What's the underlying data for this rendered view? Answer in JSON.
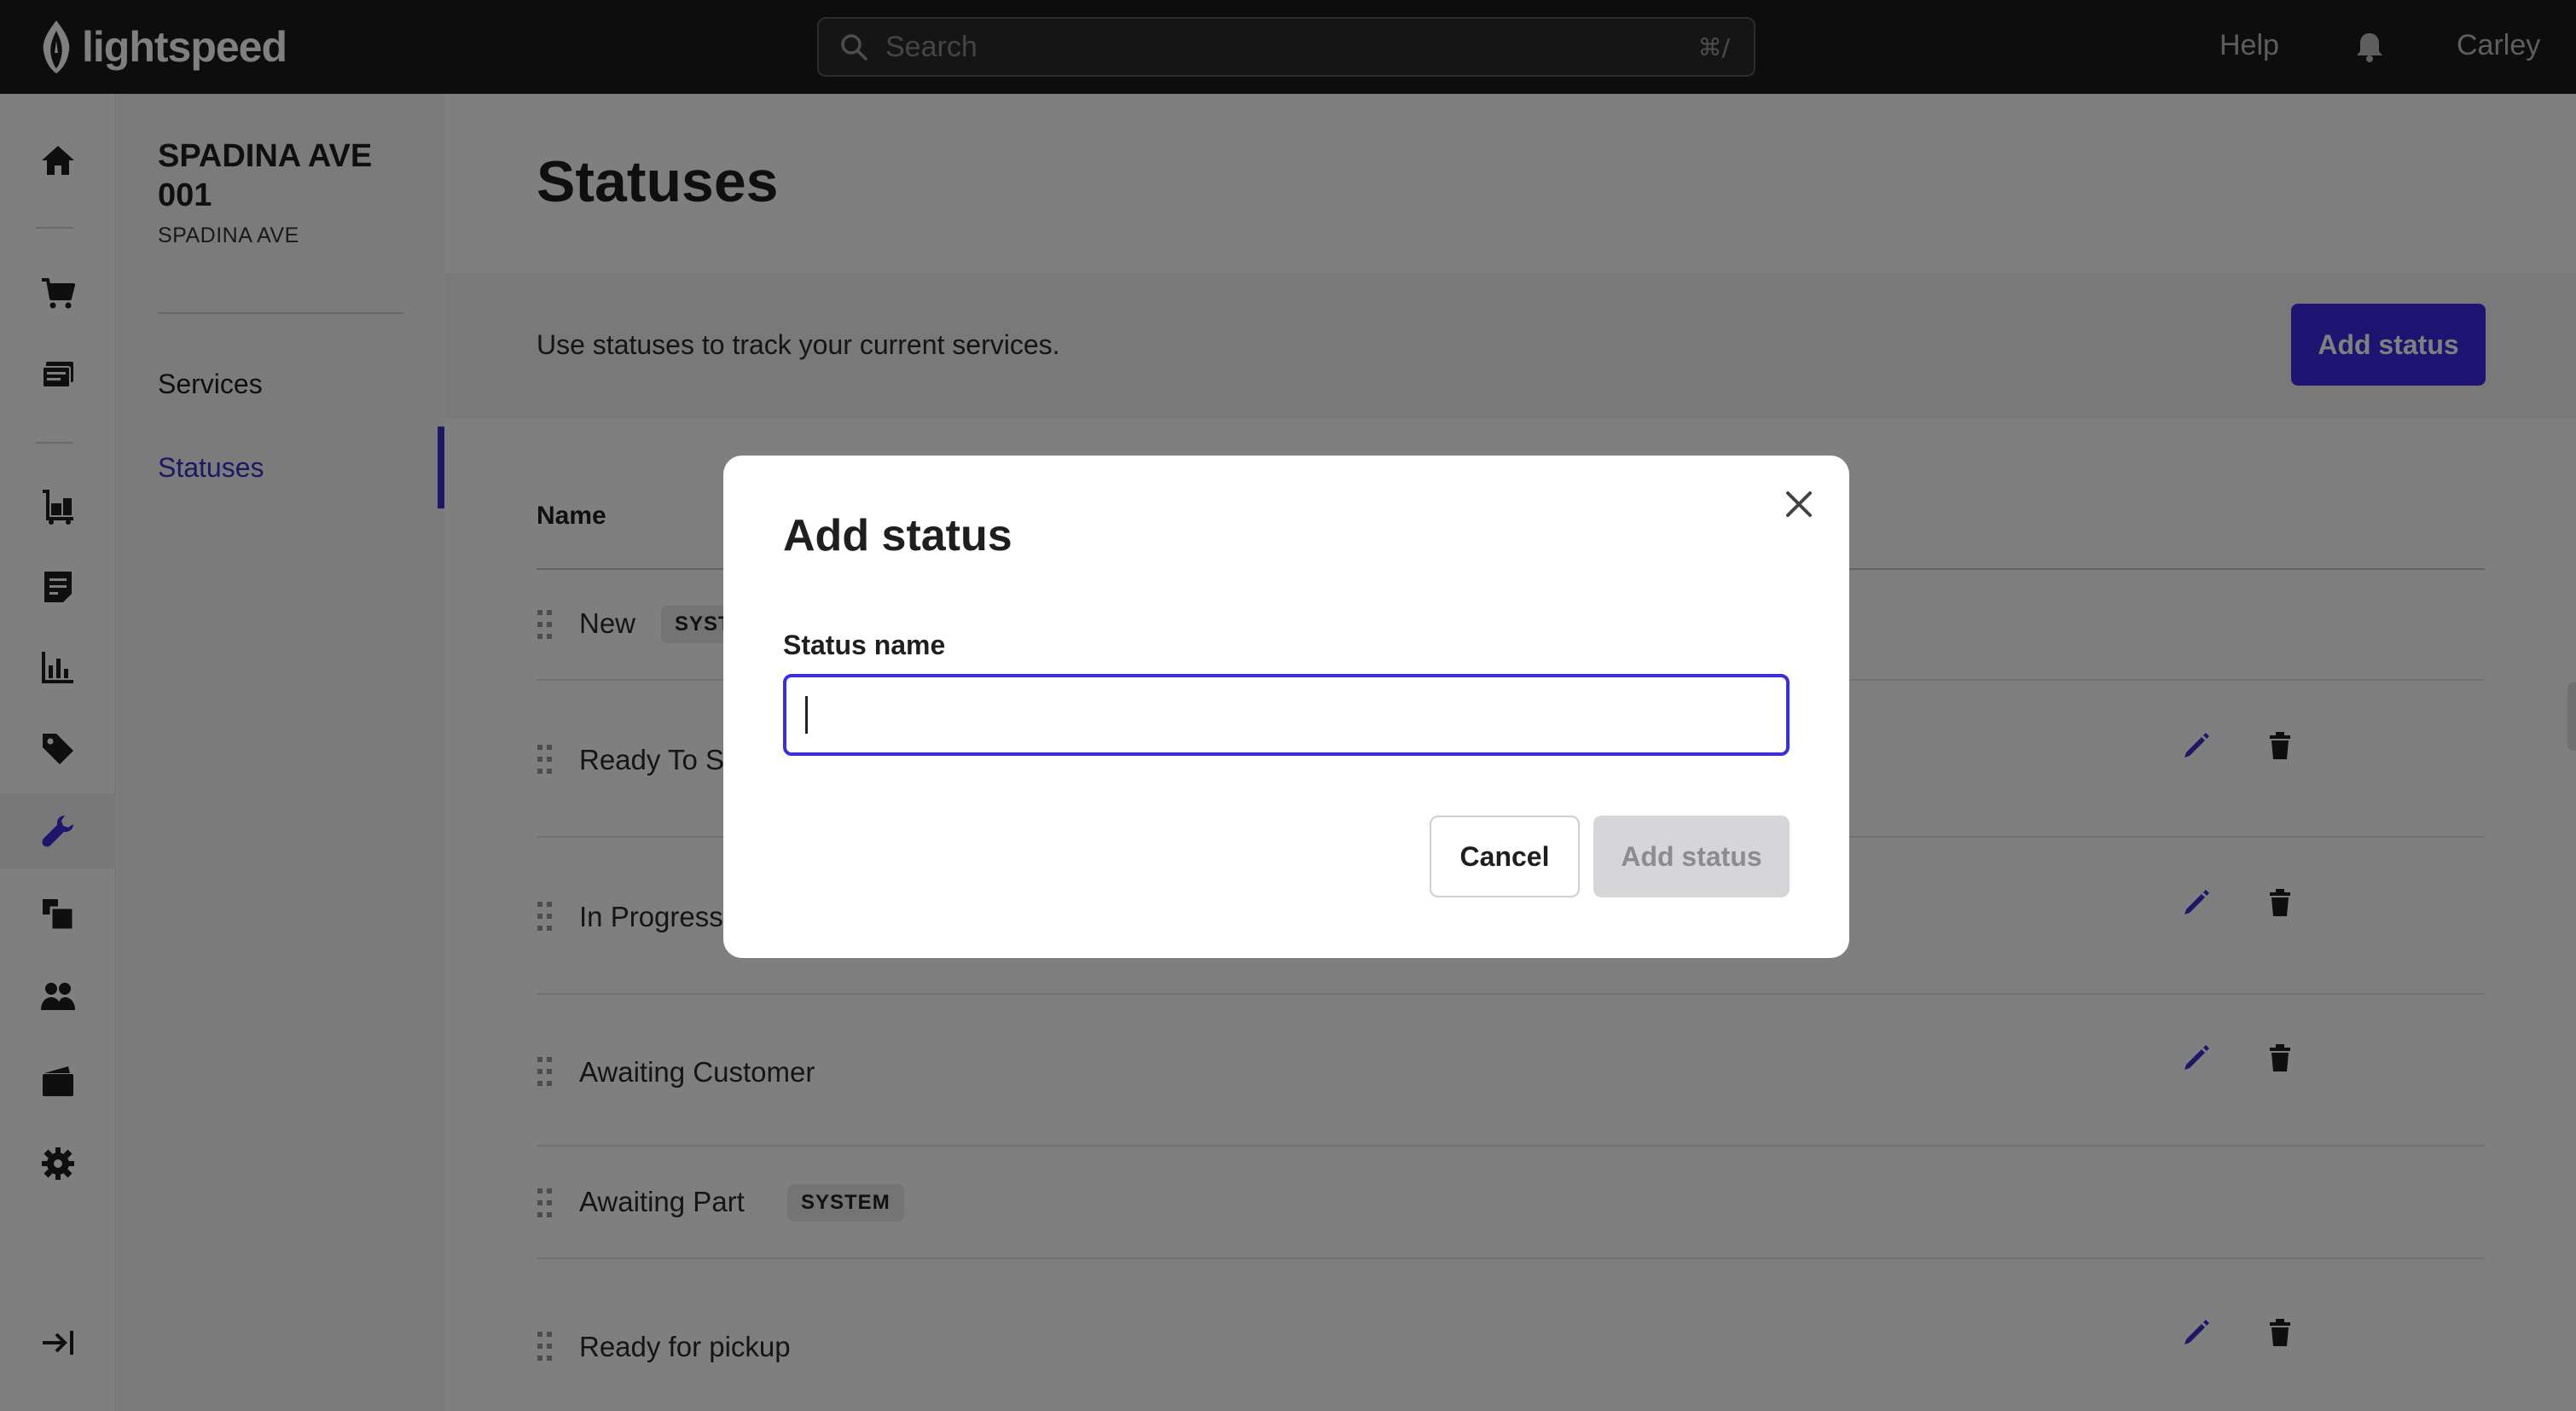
{
  "topbar": {
    "logo_text": "lightspeed",
    "search_placeholder": "Search",
    "search_shortcut": "⌘/",
    "help_label": "Help",
    "user_name": "Carley"
  },
  "rail": {
    "items": [
      {
        "icon": "home-icon"
      },
      {
        "icon": "cart-icon"
      },
      {
        "icon": "register-icon"
      },
      {
        "icon": "inventory-cart-icon"
      },
      {
        "icon": "invoice-icon"
      },
      {
        "icon": "reports-icon"
      },
      {
        "icon": "tag-icon"
      },
      {
        "icon": "wrench-icon",
        "active": true
      },
      {
        "icon": "boxes-icon"
      },
      {
        "icon": "customers-icon"
      },
      {
        "icon": "wallet-icon"
      },
      {
        "icon": "gear-icon"
      },
      {
        "icon": "collapse-icon"
      }
    ]
  },
  "subnav": {
    "store_name": "SPADINA AVE 001",
    "store_sub": "SPADINA AVE",
    "items": [
      {
        "label": "Services"
      },
      {
        "label": "Statuses",
        "active": true
      }
    ]
  },
  "main": {
    "title": "Statuses",
    "info_text": "Use statuses to track your current services.",
    "add_button": "Add status",
    "column_name": "Name",
    "rows": [
      {
        "name": "New",
        "badge": "SYSTEM",
        "actions": false
      },
      {
        "name": "Ready To Start",
        "badge": "",
        "actions": true
      },
      {
        "name": "In Progress",
        "badge": "",
        "actions": true
      },
      {
        "name": "Awaiting Customer",
        "badge": "",
        "actions": true
      },
      {
        "name": "Awaiting Part",
        "badge": "SYSTEM",
        "actions": false
      },
      {
        "name": "Ready for pickup",
        "badge": "",
        "actions": true
      }
    ]
  },
  "modal": {
    "title": "Add status",
    "field_label": "Status name",
    "field_value": "",
    "cancel_label": "Cancel",
    "submit_label": "Add status"
  },
  "colors": {
    "accent": "#3a26e0",
    "topbar": "#1b1b1b",
    "overlay": "rgba(0,0,0,0.5)",
    "disabled": "#d6d6d9"
  }
}
